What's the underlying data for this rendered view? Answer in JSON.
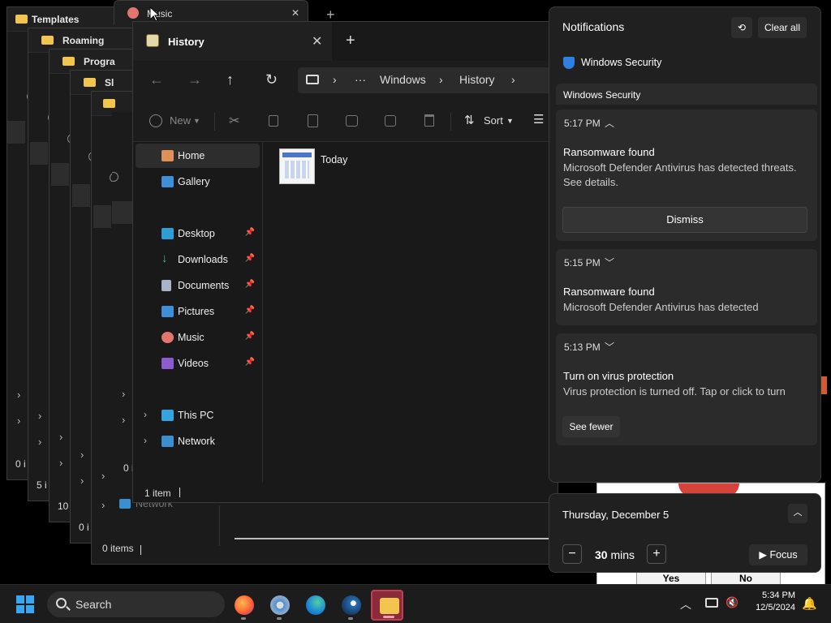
{
  "background_windows": [
    {
      "title": "Templates",
      "status": "0 i"
    },
    {
      "title": "Roaming",
      "status": "5 i"
    },
    {
      "title": "Progra",
      "status": "10"
    },
    {
      "title": "Sl",
      "status": "0 i"
    },
    {
      "title": "",
      "status": "0 items"
    },
    {
      "title": "",
      "status": "0 i"
    }
  ],
  "background_nav": {
    "network": "Network"
  },
  "music_tab": {
    "title": "Music"
  },
  "explorer": {
    "tab_title": "History",
    "new_tab": "+",
    "close": "✕",
    "nav": {
      "back": "←",
      "forward": "→",
      "up": "↑",
      "refresh": "↻"
    },
    "breadcrumb": {
      "sep": "›",
      "more": "···",
      "segments": [
        "Windows",
        "History"
      ]
    },
    "toolbar": {
      "new_label": "New",
      "sort_label": "Sort"
    },
    "sidebar": {
      "top": [
        {
          "label": "Home"
        },
        {
          "label": "Gallery"
        }
      ],
      "quick": [
        {
          "label": "Desktop"
        },
        {
          "label": "Downloads"
        },
        {
          "label": "Documents"
        },
        {
          "label": "Pictures"
        },
        {
          "label": "Music"
        },
        {
          "label": "Videos"
        }
      ],
      "tree": [
        {
          "label": "This PC"
        },
        {
          "label": "Network"
        }
      ]
    },
    "files": [
      {
        "name": "Today"
      }
    ],
    "status": "1 item"
  },
  "notifications": {
    "header": "Notifications",
    "clear_all": "Clear all",
    "app_name": "Windows Security",
    "group_header": "Windows Security",
    "items": [
      {
        "time": "5:17 PM",
        "title": "Ransomware found",
        "body": "Microsoft Defender Antivirus has detected threats. See details.",
        "action": "Dismiss"
      },
      {
        "time": "5:15 PM",
        "title": "Ransomware found",
        "body": "Microsoft Defender Antivirus has detected"
      },
      {
        "time": "5:13 PM",
        "title": "Turn on virus protection",
        "body": "Virus protection is turned off. Tap or click to turn",
        "action": "See fewer"
      }
    ]
  },
  "calendar": {
    "date": "Thursday, December 5",
    "minutes": "30",
    "unit": "mins",
    "focus_label": "Focus"
  },
  "popup": {
    "yes": "Yes",
    "no": "No"
  },
  "taskbar": {
    "search_placeholder": "Search",
    "time": "5:34 PM",
    "date": "12/5/2024"
  },
  "colors": {
    "accent": "#3aa5f0",
    "shield": "#2f7fe0",
    "alert_red": "#d6433a",
    "folder": "#f2c54f"
  }
}
